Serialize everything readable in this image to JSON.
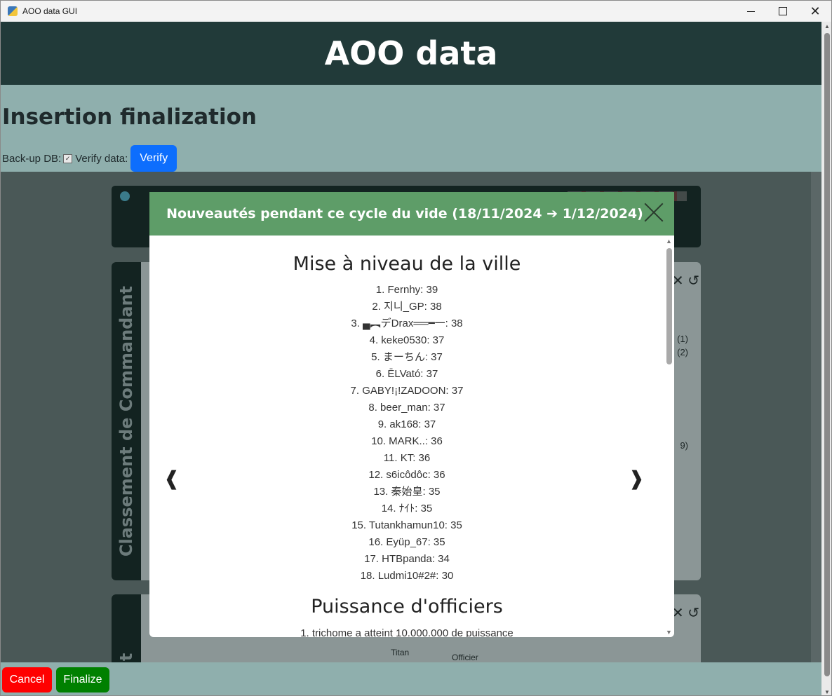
{
  "window": {
    "title": "AOO data GUI",
    "controls": {
      "minimize": "minimize-icon",
      "maximize": "maximize-icon",
      "close": "close-icon"
    }
  },
  "header": {
    "title": "AOO data"
  },
  "page": {
    "section_title": "Insertion finalization",
    "backup_label": "Back-up DB:",
    "backup_checked": true,
    "verify_label": "Verify data:",
    "verify_button": "Verify"
  },
  "background": {
    "card1_tab": "Classement de Commandant",
    "card2_tab": "ant",
    "card_controls": "✕ ↺",
    "card1_side_texts": [
      "(1)",
      "(2)",
      "9)"
    ],
    "chart_labels": [
      "Titan",
      "Officier"
    ]
  },
  "modal": {
    "title": "Nouveautés pendant ce cycle du vide (18/11/2024 ➔ 1/12/2024)",
    "prev": "❰",
    "next": "❱",
    "sections": [
      {
        "heading": "Mise à niveau de la ville",
        "items": [
          "1. Fernhy: 39",
          "2. 지니_GP: 38",
          "3. ▄︻デDrax══━一: 38",
          "4. keke0530: 37",
          "5. まーちん: 37",
          "6. ĒLVató: 37",
          "7. GABY!¡!ZADOON: 37",
          "8. beer_man: 37",
          "9. ak168: 37",
          "10. MARK..: 36",
          "11. KT: 36",
          "12. s6icôdôc: 36",
          "13. 秦始皇: 35",
          "14. ﾅｲﾄ: 35",
          "15. Tutankhamun10: 35",
          "16. Eyüp_67: 35",
          "17. HTBpanda: 34",
          "18. Ludmi10#2#: 30"
        ]
      },
      {
        "heading": "Puissance d'officiers",
        "items": [
          "1. trichome a atteint 10.000.000 de puissance"
        ]
      }
    ]
  },
  "footer": {
    "cancel": "Cancel",
    "finalize": "Finalize"
  },
  "colors": {
    "header_bg": "#213a39",
    "page_bg": "#8fafad",
    "modal_header": "#5e9d68",
    "verify": "#0d6efd",
    "cancel": "#ff0000",
    "finalize": "#008000"
  }
}
